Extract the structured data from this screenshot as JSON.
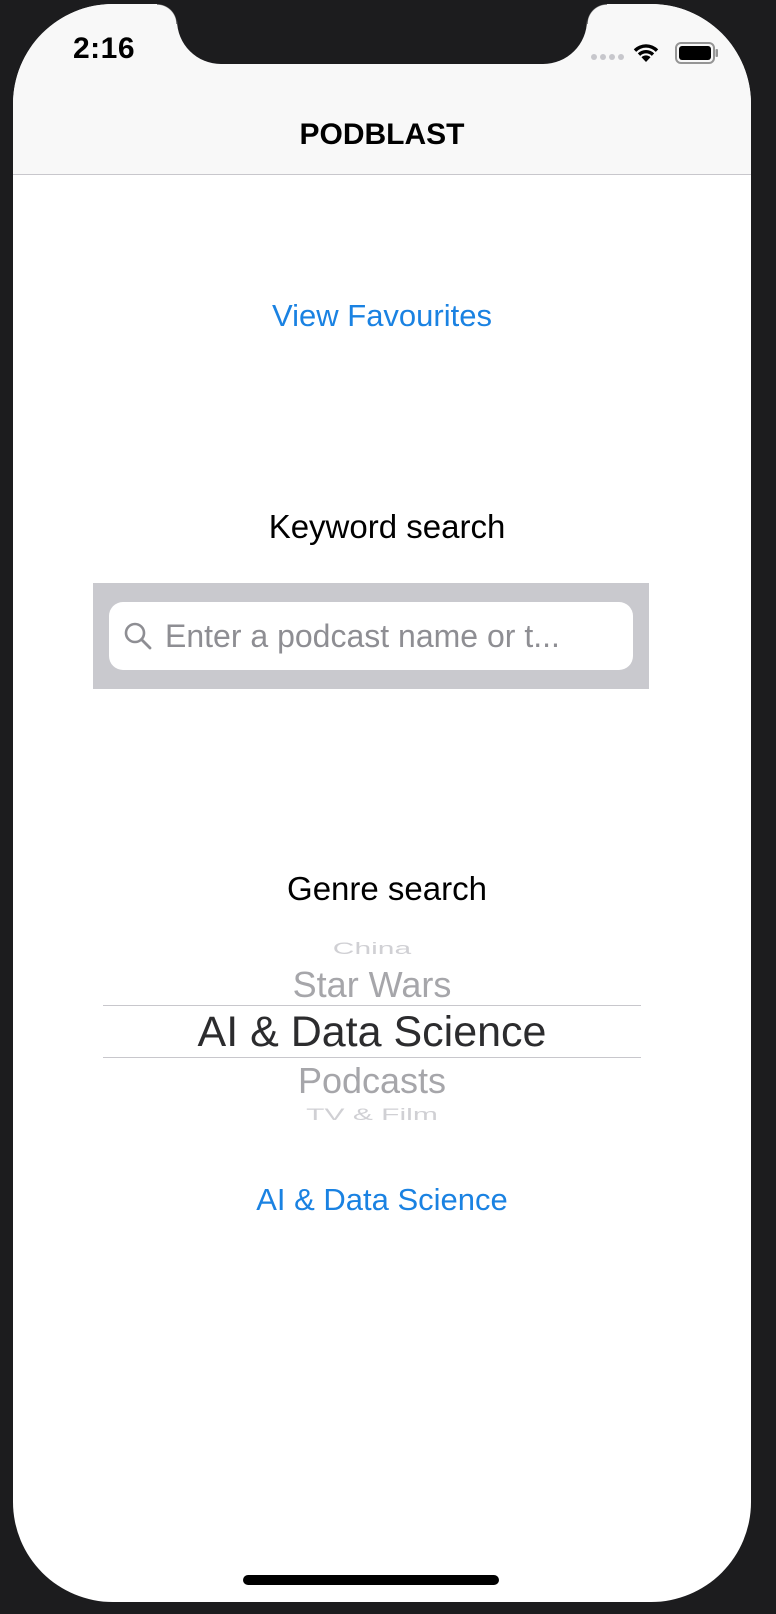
{
  "status_bar": {
    "time": "2:16"
  },
  "nav": {
    "title": "PODBLAST"
  },
  "favourites_button": {
    "label": "View Favourites"
  },
  "keyword_search": {
    "label": "Keyword search",
    "placeholder": "Enter a podcast name or t..."
  },
  "genre_search": {
    "label": "Genre search",
    "picker_items": [
      "China",
      "Star Wars",
      "AI & Data Science",
      "Podcasts",
      "TV & Film"
    ],
    "selected": "AI & Data Science",
    "result_button_label": "AI & Data Science"
  },
  "colors": {
    "accent": "#1a82e2",
    "nav_background": "#f8f8f8",
    "search_bar_background": "#c9c9ce"
  },
  "icons": {
    "search": "magnifying-glass",
    "wifi": "wifi",
    "battery": "battery-full",
    "signal": "cellular-dots"
  }
}
